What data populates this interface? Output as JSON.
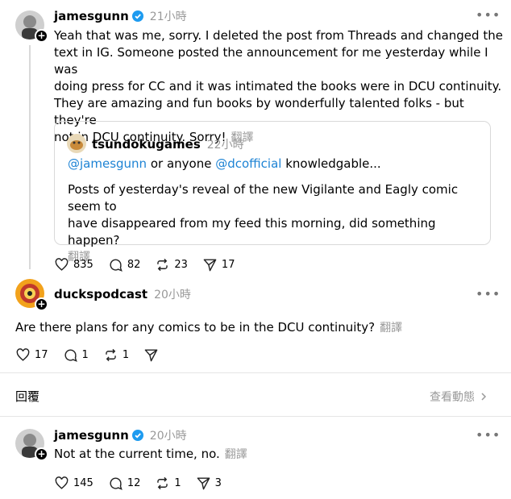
{
  "posts": [
    {
      "username": "jamesgunn",
      "time": "21小時",
      "lines": [
        "Yeah that was me, sorry. I deleted the post from Threads and changed the",
        "text in IG. Someone posted the announcement for me yesterday while I was",
        "doing press for CC and it was intimated the books were in DCU continuity.",
        "They are amazing and fun books by wonderfully talented folks - but they're",
        "not in DCU continuity. Sorry!"
      ],
      "translate": "翻譯",
      "likes": "835",
      "comments": "82",
      "reposts": "23",
      "shares": "17"
    },
    {
      "username": "duckspodcast",
      "time": "20小時",
      "text": "Are there plans for any comics to be in the DCU continuity?",
      "translate": "翻譯",
      "likes": "17",
      "comments": "1",
      "reposts": "1"
    },
    {
      "username": "jamesgunn",
      "time": "20小時",
      "text": "Not at the current time, no.",
      "translate": "翻譯",
      "likes": "145",
      "comments": "12",
      "reposts": "1",
      "shares": "3"
    }
  ],
  "quote": {
    "username": "tsundokugames",
    "time": "22小時",
    "mention1": "@jamesgunn",
    "mid_text": " or anyone ",
    "mention2": "@dcofficial",
    "end_text": " knowledgable...",
    "line1": "Posts of yesterday's reveal of the new Vigilante and Eagly comic seem to",
    "line2": "have disappeared from my feed this morning, did something happen?",
    "translate": "翻譯"
  },
  "replies_bar": {
    "label": "回覆",
    "view_activity": "查看動態"
  },
  "colors": {
    "verified": "#1d9bf0",
    "link": "#1d83d4",
    "muted": "#999999"
  }
}
